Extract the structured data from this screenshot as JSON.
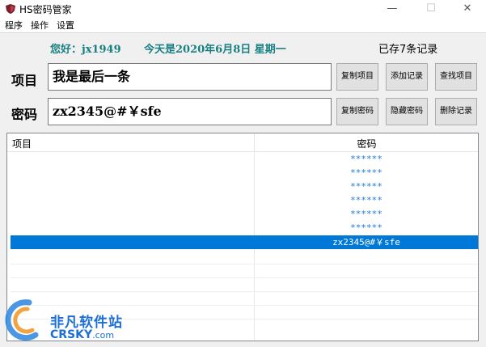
{
  "window": {
    "title": "HS密码管家",
    "min_glyph": "—",
    "max_glyph": "☐",
    "close_glyph": "✕"
  },
  "menu": [
    "程序",
    "操作",
    "设置"
  ],
  "header": {
    "greeting": "您好：jx1949",
    "date": "今天是2020年6月8日 星期一",
    "record_count": "已存7条记录"
  },
  "form": {
    "item_label": "项目",
    "item_value": "我是最后一条",
    "password_label": "密码",
    "password_value": "zx2345@#￥sfe"
  },
  "buttons": {
    "copy_item": "复制项目",
    "add_record": "添加记录",
    "find_item": "查找项目",
    "copy_password": "复制密码",
    "hide_password": "隐藏密码",
    "delete_record": "删除记录"
  },
  "table": {
    "columns": [
      "项目",
      "密码"
    ],
    "rows": [
      {
        "item": "",
        "password": "******"
      },
      {
        "item": "",
        "password": "******"
      },
      {
        "item": "",
        "password": "******"
      },
      {
        "item": "",
        "password": "******"
      },
      {
        "item": "",
        "password": "******"
      },
      {
        "item": "",
        "password": "******"
      },
      {
        "item": "",
        "password": "zx2345@#￥sfe",
        "selected": true
      }
    ]
  },
  "watermark": {
    "cn": "非凡软件站",
    "en": "CRSKY",
    "suffix": ".com"
  },
  "colors": {
    "accent": "#1a7f82",
    "selection": "#0078d7",
    "masked": "#1e7ad6",
    "watermark": "#1d6fd6"
  }
}
